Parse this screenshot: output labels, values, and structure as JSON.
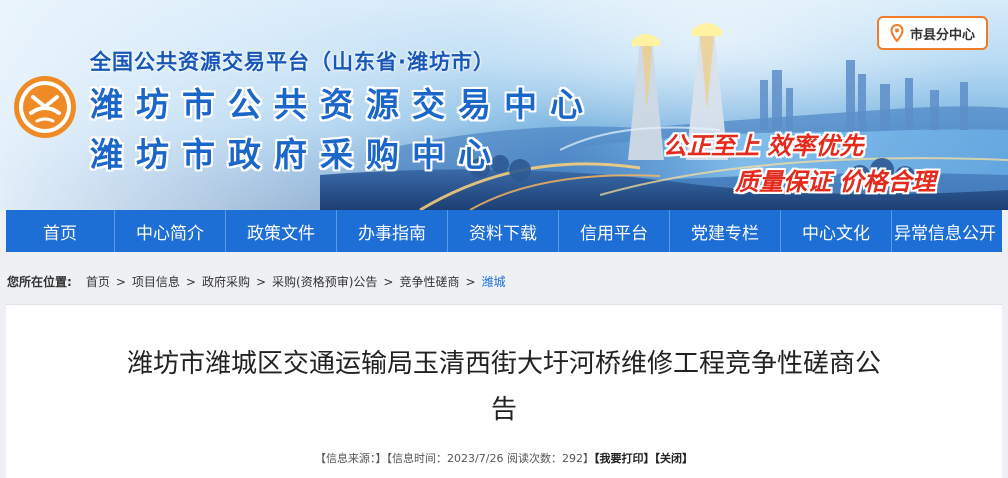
{
  "banner": {
    "line1": "全国公共资源交易平台（山东省·潍坊市）",
    "line2": "潍坊市公共资源交易中心",
    "line3": "潍坊市政府采购中心",
    "slogan1": "公正至上 效率优先",
    "slogan2": "质量保证 价格合理",
    "city_button": "市县分中心",
    "colors": {
      "brand_blue": "#1b66c9",
      "slogan_red": "#e42a1c",
      "logo_orange": "#f08a24",
      "pin_orange": "#f07d2a"
    }
  },
  "nav": {
    "items": [
      "首页",
      "中心简介",
      "政策文件",
      "办事指南",
      "资料下载",
      "信用平台",
      "党建专栏",
      "中心文化",
      "异常信息公开"
    ],
    "color": "#1d6fd6"
  },
  "breadcrumb": {
    "label": "您所在位置:",
    "items": [
      "首页",
      "项目信息",
      "政府采购",
      "采购(资格预审)公告",
      "竞争性磋商"
    ],
    "current": "潍城"
  },
  "article": {
    "title_line1": "潍坊市潍城区交通运输局玉清西街大圩河桥维修工程竞争性磋商公",
    "title_line2": "告",
    "meta_source": "【信息来源：】",
    "meta_time": "【信息时间：2023/7/26 阅读次数：292】",
    "print_label": "【我要打印】",
    "close_label": "【关闭】"
  }
}
